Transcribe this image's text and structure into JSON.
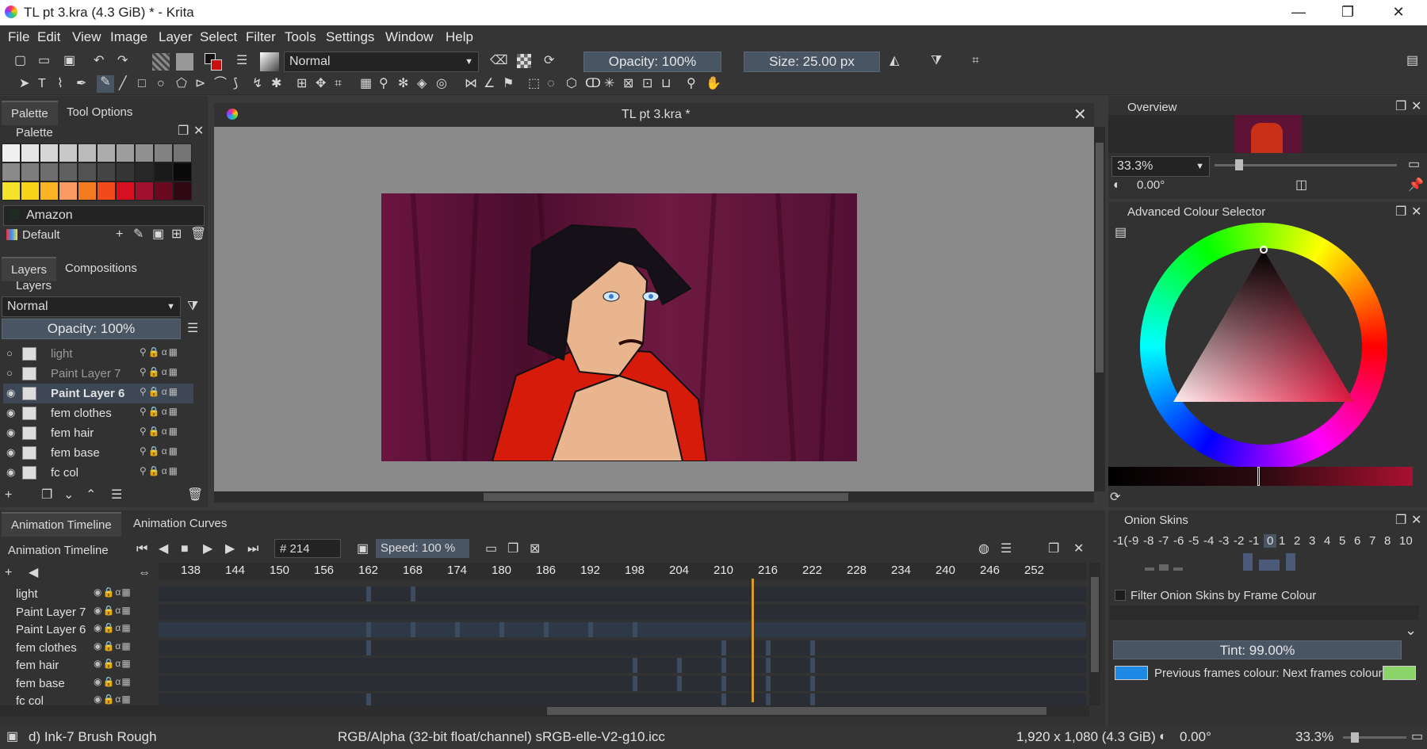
{
  "window": {
    "title": "TL pt 3.kra (4.3 GiB)  * - Krita"
  },
  "menu": [
    "File",
    "Edit",
    "View",
    "Image",
    "Layer",
    "Select",
    "Filter",
    "Tools",
    "Settings",
    "Window",
    "Help"
  ],
  "toolbar": {
    "blend_mode": "Normal",
    "opacity": "Opacity: 100%",
    "size": "Size: 25.00 px"
  },
  "docker_left": {
    "tabs_top": [
      "Palette",
      "Tool Options"
    ],
    "palette_title": "Palette",
    "palette_name": "Amazon",
    "palette_set": "Default",
    "tabs_layers": [
      "Layers",
      "Compositions"
    ],
    "layers_title": "Layers",
    "blend": "Normal",
    "opacity": "Opacity:  100%",
    "layers": [
      {
        "name": "light",
        "visible": false,
        "selected": false
      },
      {
        "name": "Paint Layer 7",
        "visible": false,
        "selected": false
      },
      {
        "name": "Paint Layer 6",
        "visible": true,
        "selected": true
      },
      {
        "name": "fem clothes",
        "visible": true,
        "selected": false
      },
      {
        "name": "fem hair",
        "visible": true,
        "selected": false
      },
      {
        "name": "fem base",
        "visible": true,
        "selected": false
      },
      {
        "name": "fc col",
        "visible": true,
        "selected": false
      }
    ]
  },
  "document": {
    "tab": "TL pt 3.kra *"
  },
  "overview": {
    "title": "Overview",
    "zoom": "33.3%",
    "angle": "0.00°"
  },
  "colour_selector": {
    "title": "Advanced Colour Selector"
  },
  "onion": {
    "title": "Onion Skins",
    "frames": [
      "-1(",
      "-9",
      "-8",
      "-7",
      "-6",
      "-5",
      "-4",
      "-3",
      "-2",
      "-1",
      "0",
      "1",
      "2",
      "3",
      "4",
      "5",
      "6",
      "7",
      "8",
      "10"
    ],
    "filter_label": "Filter Onion Skins by Frame Colour",
    "tint": "Tint: 99.00%",
    "colours_label": "Previous frames colour: Next frames colour",
    "prev_color": "#1e88e5",
    "next_color": "#8bd46a"
  },
  "timeline": {
    "tabs": [
      "Animation Timeline",
      "Animation Curves"
    ],
    "title": "Animation Timeline",
    "frame": "# 214",
    "speed": "Speed: 100 %",
    "ruler": [
      "138",
      "144",
      "150",
      "156",
      "162",
      "168",
      "174",
      "180",
      "186",
      "192",
      "198",
      "204",
      "210",
      "216",
      "222",
      "228",
      "234",
      "240",
      "246",
      "252"
    ],
    "rows": [
      "light",
      "Paint Layer 7",
      "Paint Layer 6",
      "fem clothes",
      "fem hair",
      "fem base",
      "fc col"
    ]
  },
  "status": {
    "brush": "d) Ink-7 Brush Rough",
    "colorspace": "RGB/Alpha (32-bit float/channel)  sRGB-elle-V2-g10.icc",
    "dims": "1,920 x 1,080 (4.3 GiB)",
    "rotation": "0.00°",
    "zoom": "33.3%"
  },
  "colors": {
    "accent": "#4a5564",
    "selection": "#3d4756",
    "canvas_bg": "#5b1030"
  }
}
